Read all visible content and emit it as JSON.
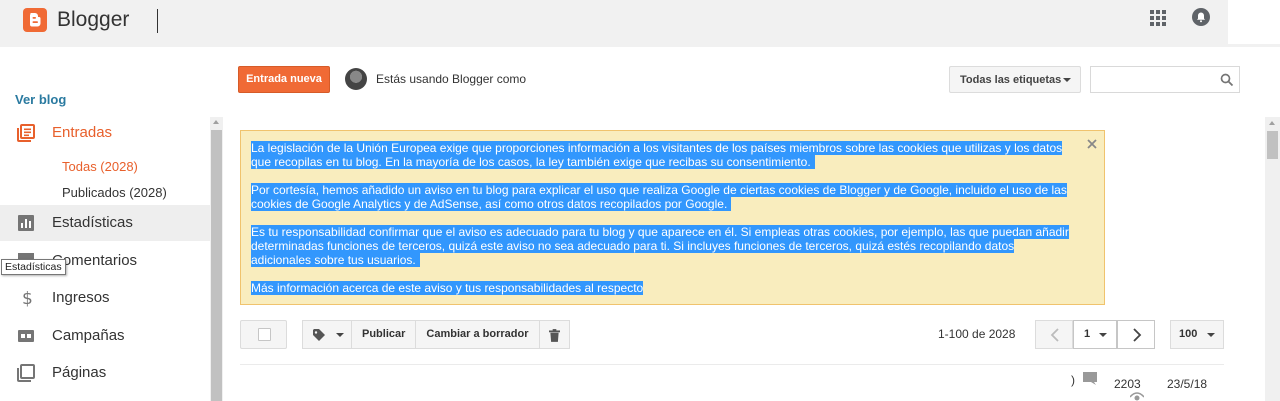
{
  "header": {
    "brand": "Blogger"
  },
  "sidebar": {
    "view_blog": "Ver blog",
    "items": [
      {
        "label": "Entradas",
        "icon": "posts-icon"
      },
      {
        "label": "Estadísticas",
        "icon": "stats-icon"
      },
      {
        "label": "Comentarios",
        "icon": "comments-icon"
      },
      {
        "label": "Ingresos",
        "icon": "dollar-icon"
      },
      {
        "label": "Campañas",
        "icon": "ad-icon"
      },
      {
        "label": "Páginas",
        "icon": "pages-icon"
      }
    ],
    "sub_items": [
      {
        "label": "Todas (2028)"
      },
      {
        "label": "Publicados (2028)"
      }
    ],
    "tooltip": "Estadísticas"
  },
  "actions": {
    "new_post": "Entrada nueva",
    "using_as": "Estás usando Blogger como",
    "labels_dropdown": "Todas las etiquetas",
    "search_value": ""
  },
  "banner": {
    "paragraphs": [
      "La legislación de la Unión Europea exige que proporciones información a los visitantes de los países miembros sobre las cookies que utilizas y los datos que recopilas en tu blog. En la mayoría de los casos, la ley también exige que recibas su consentimiento.",
      "Por cortesía, hemos añadido un aviso en tu blog para explicar el uso que realiza Google de ciertas cookies de Blogger y de Google, incluido el uso de las cookies de Google Analytics y de AdSense, así como otros datos recopilados por Google.",
      "Es tu responsabilidad confirmar que el aviso es adecuado para tu blog y que aparece en él. Si empleas otras cookies, por ejemplo, las que puedan añadir determinadas funciones de terceros, quizá este aviso no sea adecuado para ti. Si incluyes funciones de terceros, quizá estés recopilando datos adicionales sobre tus usuarios.",
      "Más información acerca de este aviso y tus responsabilidades al respecto"
    ]
  },
  "toolbar": {
    "publish": "Publicar",
    "to_draft": "Cambiar a borrador",
    "range": "1-100 de 2028",
    "page": "1",
    "per_page": "100"
  },
  "row": {
    "paren": ")",
    "views": "2203",
    "date": "23/5/18"
  },
  "colors": {
    "brand": "#f06a35",
    "active": "#e8602c",
    "link": "#2a7aa0",
    "banner_bg": "#f9edbe",
    "selection": "#3297fd"
  }
}
